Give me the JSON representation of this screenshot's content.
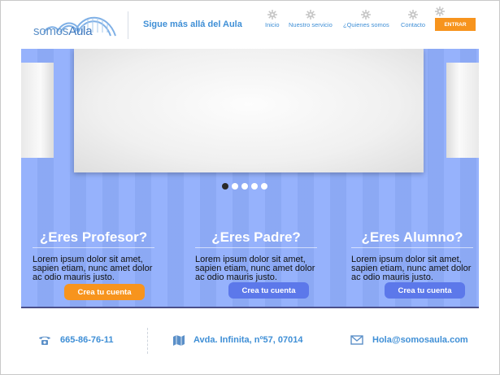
{
  "header": {
    "logo_text_a": "somos",
    "logo_text_b": "Aula",
    "tagline": "Sigue más allá del Aula",
    "nav": [
      {
        "label": "Inicio",
        "icon": "gear-icon"
      },
      {
        "label": "Nuestro servicio",
        "icon": "gear-icon"
      },
      {
        "label": "¿Quienes somos",
        "icon": "gear-icon"
      },
      {
        "label": "Contacto",
        "icon": "gear-icon"
      }
    ],
    "login_label": "ENTRAR"
  },
  "slider": {
    "dots_count": 5,
    "active_dot": 0
  },
  "audiences": [
    {
      "title": "¿Eres Profesor?",
      "text": "Lorem ipsum dolor sit amet, sapien etiam, nunc amet dolor ac odio mauris justo.",
      "button": "Crea tu cuenta",
      "button_color": "#f7941d"
    },
    {
      "title": "¿Eres Padre?",
      "text": "Lorem ipsum dolor sit amet, sapien etiam, nunc amet dolor ac odio mauris justo.",
      "button": "Crea tu cuenta",
      "button_color": "#5c78ea"
    },
    {
      "title": "¿Eres Alumno?",
      "text": "Lorem ipsum dolor sit amet, sapien etiam, nunc amet dolor ac odio mauris justo.",
      "button": "Crea tu cuenta",
      "button_color": "#5c78ea"
    }
  ],
  "footer": {
    "phone": "665-86-76-11",
    "address": "Avda. Infinita, nº57, 07014",
    "email": "Hola@somosaula.com"
  },
  "colors": {
    "accent": "#3f8fd6",
    "orange": "#f7941d",
    "hero_bg": "#90aefc",
    "button_blue": "#5c78ea"
  }
}
